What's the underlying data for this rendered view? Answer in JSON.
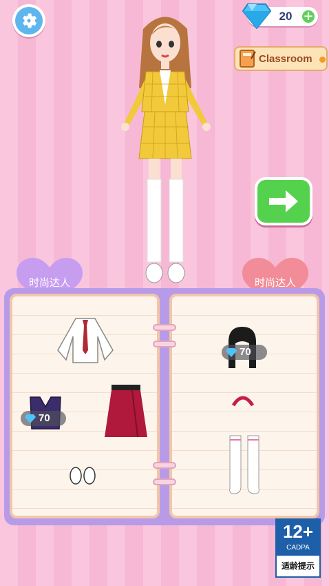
{
  "top": {
    "gem_count": "20",
    "classroom_label": "Classroom"
  },
  "tabs": {
    "left_label": "时尚达人",
    "right_label": "时尚达人"
  },
  "items_left": [
    {
      "name": "white shirt with red tie",
      "price": ""
    },
    {
      "name": "navy sweater vest",
      "price": "70"
    },
    {
      "name": "red skirt",
      "price": ""
    },
    {
      "name": "white shoes",
      "price": ""
    }
  ],
  "items_right": [
    {
      "name": "black hair",
      "price": "70"
    },
    {
      "name": "red headband",
      "price": ""
    },
    {
      "name": "white knee socks",
      "price": ""
    }
  ],
  "rating": {
    "age": "12+",
    "org": "CADPA",
    "note": "适龄提示"
  },
  "colors": {
    "gem": "#4fc3f7",
    "go_button": "#55d24d",
    "panel": "#b89be8",
    "heart_left": "#c79df0",
    "heart_right": "#f28c98"
  }
}
